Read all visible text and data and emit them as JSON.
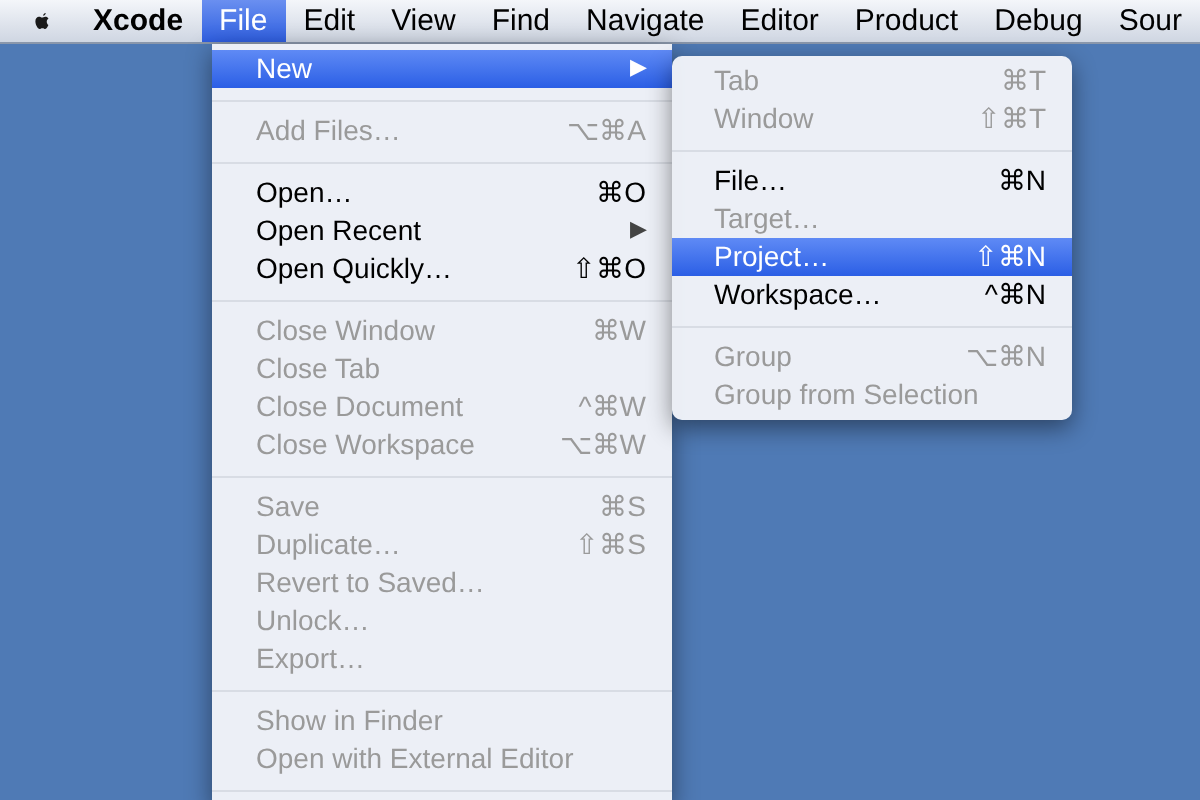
{
  "menu_bar": {
    "app_name": "Xcode",
    "menus": [
      {
        "label": "File",
        "selected": true
      },
      {
        "label": "Edit",
        "selected": false
      },
      {
        "label": "View",
        "selected": false
      },
      {
        "label": "Find",
        "selected": false
      },
      {
        "label": "Navigate",
        "selected": false
      },
      {
        "label": "Editor",
        "selected": false
      },
      {
        "label": "Product",
        "selected": false
      },
      {
        "label": "Debug",
        "selected": false
      },
      {
        "label": "Sour",
        "selected": false
      }
    ]
  },
  "file_menu": {
    "items": [
      {
        "kind": "item",
        "label": "New",
        "arrow": "▶",
        "disabled": false,
        "selected": true
      },
      {
        "kind": "separator"
      },
      {
        "kind": "item",
        "label": "Add Files…",
        "shortcut": "⌥⌘A",
        "disabled": true,
        "selected": false
      },
      {
        "kind": "separator"
      },
      {
        "kind": "item",
        "label": "Open…",
        "shortcut": "⌘O",
        "disabled": false,
        "selected": false
      },
      {
        "kind": "item",
        "label": "Open Recent",
        "arrow": "▶",
        "disabled": false,
        "selected": false
      },
      {
        "kind": "item",
        "label": "Open Quickly…",
        "shortcut": "⇧⌘O",
        "disabled": false,
        "selected": false
      },
      {
        "kind": "separator"
      },
      {
        "kind": "item",
        "label": "Close Window",
        "shortcut": "⌘W",
        "disabled": true,
        "selected": false
      },
      {
        "kind": "item",
        "label": "Close Tab",
        "disabled": true,
        "selected": false
      },
      {
        "kind": "item",
        "label": "Close Document",
        "shortcut": "^⌘W",
        "disabled": true,
        "selected": false
      },
      {
        "kind": "item",
        "label": "Close Workspace",
        "shortcut": "⌥⌘W",
        "disabled": true,
        "selected": false
      },
      {
        "kind": "separator"
      },
      {
        "kind": "item",
        "label": "Save",
        "shortcut": "⌘S",
        "disabled": true,
        "selected": false
      },
      {
        "kind": "item",
        "label": "Duplicate…",
        "shortcut": "⇧⌘S",
        "disabled": true,
        "selected": false
      },
      {
        "kind": "item",
        "label": "Revert to Saved…",
        "disabled": true,
        "selected": false
      },
      {
        "kind": "item",
        "label": "Unlock…",
        "disabled": true,
        "selected": false
      },
      {
        "kind": "item",
        "label": "Export…",
        "disabled": true,
        "selected": false
      },
      {
        "kind": "separator"
      },
      {
        "kind": "item",
        "label": "Show in Finder",
        "disabled": true,
        "selected": false
      },
      {
        "kind": "item",
        "label": "Open with External Editor",
        "disabled": true,
        "selected": false
      },
      {
        "kind": "separator"
      }
    ]
  },
  "new_submenu": {
    "items": [
      {
        "kind": "item",
        "label": "Tab",
        "shortcut": "⌘T",
        "disabled": true,
        "selected": false
      },
      {
        "kind": "item",
        "label": "Window",
        "shortcut": "⇧⌘T",
        "disabled": true,
        "selected": false
      },
      {
        "kind": "separator"
      },
      {
        "kind": "item",
        "label": "File…",
        "shortcut": "⌘N",
        "disabled": false,
        "selected": false
      },
      {
        "kind": "item",
        "label": "Target…",
        "disabled": true,
        "selected": false
      },
      {
        "kind": "item",
        "label": "Project…",
        "shortcut": "⇧⌘N",
        "disabled": false,
        "selected": true
      },
      {
        "kind": "item",
        "label": "Workspace…",
        "shortcut": "^⌘N",
        "disabled": false,
        "selected": false
      },
      {
        "kind": "separator"
      },
      {
        "kind": "item",
        "label": "Group",
        "shortcut": "⌥⌘N",
        "disabled": true,
        "selected": false
      },
      {
        "kind": "item",
        "label": "Group from Selection",
        "disabled": true,
        "selected": false
      }
    ]
  }
}
